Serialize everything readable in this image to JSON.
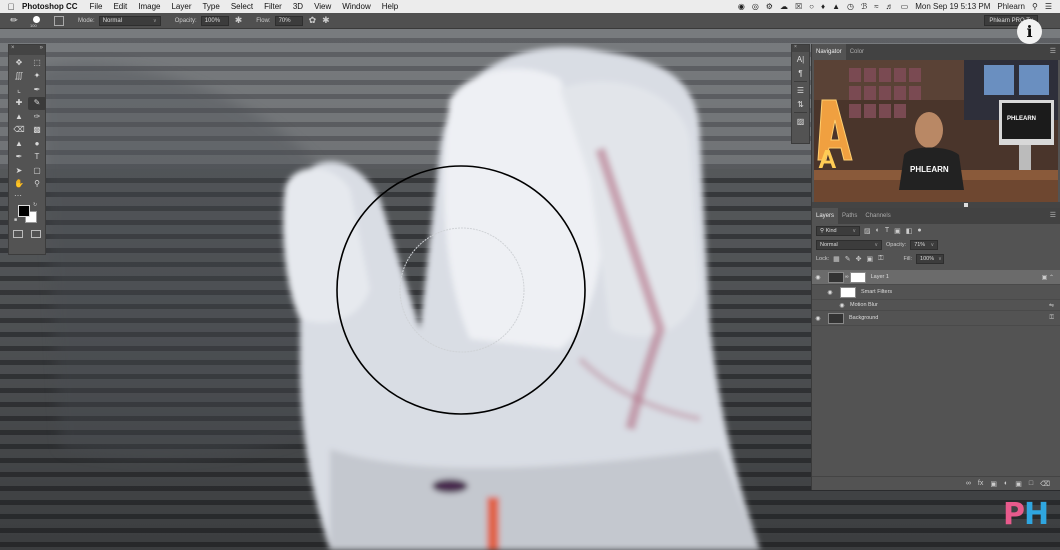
{
  "menubar": {
    "app_name": "Photoshop CC",
    "items": [
      "File",
      "Edit",
      "Image",
      "Layer",
      "Type",
      "Select",
      "Filter",
      "3D",
      "View",
      "Window",
      "Help"
    ],
    "datetime": "Mon Sep 19  5:13 PM",
    "user": "Phlearn"
  },
  "options_bar": {
    "brush_size": "100",
    "mode_label": "Mode:",
    "mode_value": "Normal",
    "opacity_label": "Opacity:",
    "opacity_value": "100%",
    "flow_label": "Flow:",
    "flow_value": "70%",
    "preset": "Phlearn PRO Tu"
  },
  "navigator_panel": {
    "tabs": [
      "Navigator",
      "Color"
    ],
    "thumb_brand": "PHLEARN",
    "thumb_letter": "A"
  },
  "layers_panel": {
    "tabs": [
      "Layers",
      "Paths",
      "Channels"
    ],
    "kind_label": "Kind",
    "blend_mode": "Normal",
    "opacity_label": "Opacity:",
    "opacity_value": "71%",
    "lock_label": "Lock:",
    "fill_label": "Fill:",
    "fill_value": "100%",
    "layers": [
      {
        "name": "Layer 1"
      },
      {
        "name": "Smart Filters"
      },
      {
        "name": "Motion Blur"
      },
      {
        "name": "Background"
      }
    ]
  },
  "logo_letters": [
    "P",
    "H"
  ],
  "colors": {
    "foreground": "#000000",
    "background": "#ffffff",
    "logo_pink": "#e85a8c",
    "logo_blue": "#2fa6e0"
  }
}
